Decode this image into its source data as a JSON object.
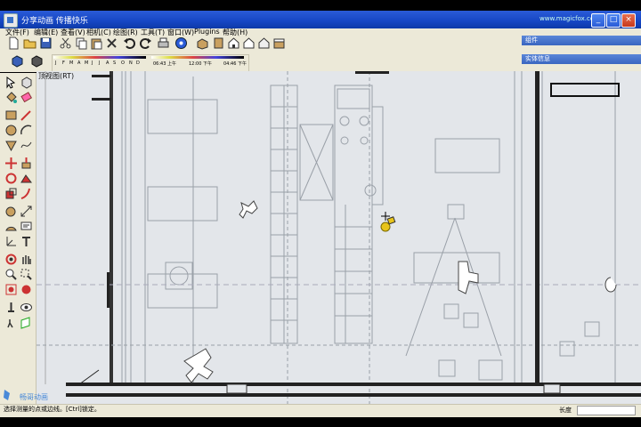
{
  "window": {
    "title": "分享动画 传播快乐",
    "watermark": "www.magicfox.cc",
    "minimize": "_",
    "maximize": "□",
    "close": "×"
  },
  "menu": [
    "文件(F)",
    "编辑(E)",
    "查看(V)",
    "相机(C)",
    "绘图(R)",
    "工具(T)",
    "窗口(W)",
    "Plugins",
    "帮助(H)"
  ],
  "shadow": {
    "months": [
      "J",
      "F",
      "M",
      "A",
      "M",
      "J",
      "J",
      "A",
      "S",
      "O",
      "N",
      "D"
    ],
    "time_start": "06:43 上午",
    "time_mid": "12:00 下午",
    "time_end": "04:46 下午"
  },
  "panels": {
    "components": "组件",
    "entity_info": "实体信息"
  },
  "viewport": {
    "view_label": "顶视图(RT)"
  },
  "status": {
    "text": "选择测量的点或边线。[Ctrl]锁定。",
    "measure_label": "长度"
  },
  "logo": {
    "text": "畅哥动画"
  },
  "colors": {
    "title_bar": "#1646c4",
    "viewport_bg": "#e3e6ea",
    "panel_header": "#3a66c0",
    "toolbar_bg": "#ece9d8"
  }
}
